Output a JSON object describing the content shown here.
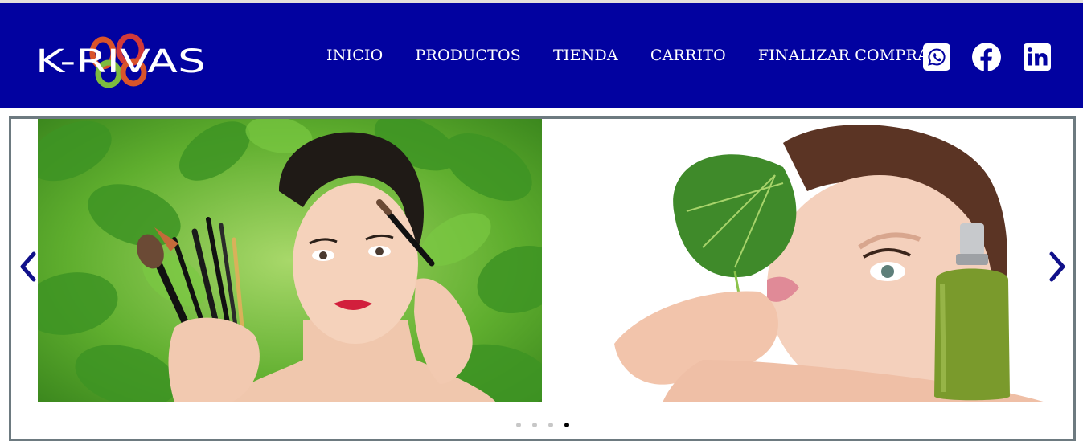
{
  "brand": {
    "logo_text": "K-RIVAS",
    "colors": {
      "header_bg": "#0202a0",
      "nav_text": "#ffffff",
      "frame_border": "#6d7a80",
      "arrow": "#10108a"
    }
  },
  "nav": {
    "items": [
      {
        "label": "INICIO"
      },
      {
        "label": "PRODUCTOS"
      },
      {
        "label": "TIENDA"
      },
      {
        "label": "CARRITO"
      },
      {
        "label": "FINALIZAR COMPRA"
      }
    ]
  },
  "social": [
    {
      "icon": "whatsapp-icon"
    },
    {
      "icon": "facebook-icon"
    },
    {
      "icon": "linkedin-icon"
    }
  ],
  "slider": {
    "slides": [
      {
        "content": "woman-with-makeup-brushes-photo"
      },
      {
        "content": "woman-with-leaf-and-bottle-photo"
      }
    ],
    "prev_icon": "chevron-left-icon",
    "next_icon": "chevron-right-icon",
    "pagination": {
      "total": 4,
      "active_index": 3
    }
  }
}
